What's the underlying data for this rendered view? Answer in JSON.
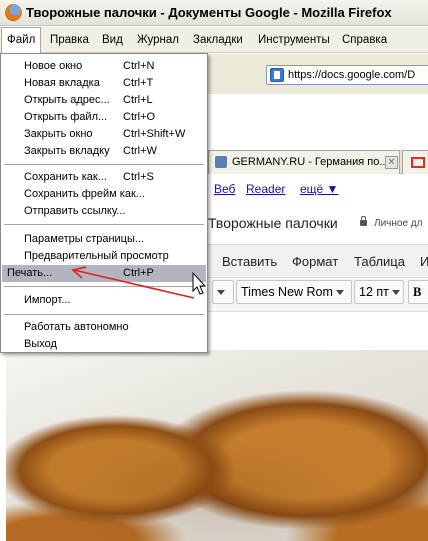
{
  "window": {
    "title": "Творожные палочки - Документы Google - Mozilla Firefox"
  },
  "menubar": {
    "items": [
      "Файл",
      "Правка",
      "Вид",
      "Журнал",
      "Закладки",
      "Инструменты",
      "Справка"
    ]
  },
  "navbar": {
    "url": "https://docs.google.com/D"
  },
  "tabs": [
    {
      "label": "GERMANY.RU - Германия по..."
    }
  ],
  "google_links": {
    "web": "Веб",
    "reader": "Reader",
    "more": "ещё ▼"
  },
  "doc": {
    "title": "Творожные палочки",
    "private_label": "Личное дл",
    "menu": [
      "Вставить",
      "Формат",
      "Таблица",
      "И"
    ],
    "font_family": "Times New Rom",
    "font_size": "12 пт",
    "bold": "B"
  },
  "file_menu": {
    "items": [
      {
        "label": "Новое окно",
        "shortcut": "Ctrl+N"
      },
      {
        "label": "Новая вкладка",
        "shortcut": "Ctrl+T"
      },
      {
        "label": "Открыть адрес...",
        "shortcut": "Ctrl+L"
      },
      {
        "label": "Открыть файл...",
        "shortcut": "Ctrl+O"
      },
      {
        "label": "Закрыть окно",
        "shortcut": "Ctrl+Shift+W"
      },
      {
        "label": "Закрыть вкладку",
        "shortcut": "Ctrl+W"
      },
      {
        "label": "Сохранить как...",
        "shortcut": "Ctrl+S"
      },
      {
        "label": "Сохранить фрейм как...",
        "shortcut": ""
      },
      {
        "label": "Отправить ссылку...",
        "shortcut": ""
      },
      {
        "label": "Параметры страницы...",
        "shortcut": ""
      },
      {
        "label": "Предварительный просмотр",
        "shortcut": ""
      },
      {
        "label": "Печать...",
        "shortcut": "Ctrl+P"
      },
      {
        "label": "Импорт...",
        "shortcut": ""
      },
      {
        "label": "Работать автономно",
        "shortcut": ""
      },
      {
        "label": "Выход",
        "shortcut": ""
      }
    ],
    "highlighted": "Печать..."
  },
  "colors": {
    "highlight": "#b2b4bf",
    "arrow": "#e0221c",
    "link": "#1a0dab"
  }
}
